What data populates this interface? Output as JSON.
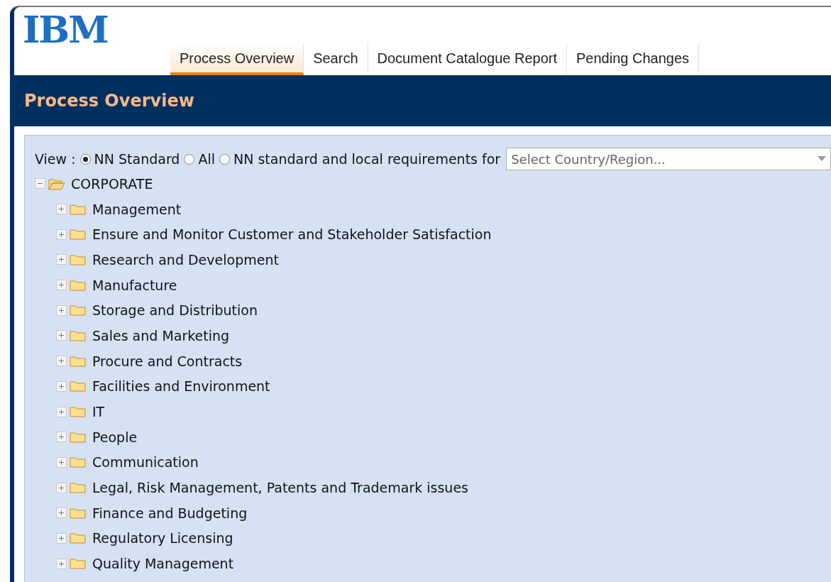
{
  "logo": {
    "text": "IBM"
  },
  "tabs": [
    {
      "label": "Process Overview",
      "selected": true
    },
    {
      "label": "Search",
      "selected": false
    },
    {
      "label": "Document Catalogue Report",
      "selected": false
    },
    {
      "label": "Pending Changes",
      "selected": false
    }
  ],
  "page_title": "Process Overview",
  "view": {
    "label": "View :",
    "options": [
      {
        "label": "NN Standard",
        "selected": true
      },
      {
        "label": "All",
        "selected": false
      },
      {
        "label": "NN standard and local requirements for",
        "selected": false
      }
    ],
    "country_select": {
      "placeholder": "Select Country/Region..."
    }
  },
  "tree": [
    {
      "label": "CORPORATE",
      "expanded": true,
      "children": [
        {
          "label": "Management",
          "expanded": false
        },
        {
          "label": "Ensure and Monitor Customer and Stakeholder Satisfaction",
          "expanded": false
        },
        {
          "label": "Research and Development",
          "expanded": false
        },
        {
          "label": "Manufacture",
          "expanded": false
        },
        {
          "label": "Storage and Distribution",
          "expanded": false
        },
        {
          "label": "Sales and Marketing",
          "expanded": false
        },
        {
          "label": "Procure and Contracts",
          "expanded": false
        },
        {
          "label": "Facilities and Environment",
          "expanded": false
        },
        {
          "label": "IT",
          "expanded": false
        },
        {
          "label": "People",
          "expanded": false
        },
        {
          "label": "Communication",
          "expanded": false
        },
        {
          "label": "Legal, Risk Management, Patents and Trademark issues",
          "expanded": false
        },
        {
          "label": "Finance and Budgeting",
          "expanded": false
        },
        {
          "label": "Regulatory Licensing",
          "expanded": false
        },
        {
          "label": "Quality Management",
          "expanded": false
        }
      ]
    }
  ]
}
